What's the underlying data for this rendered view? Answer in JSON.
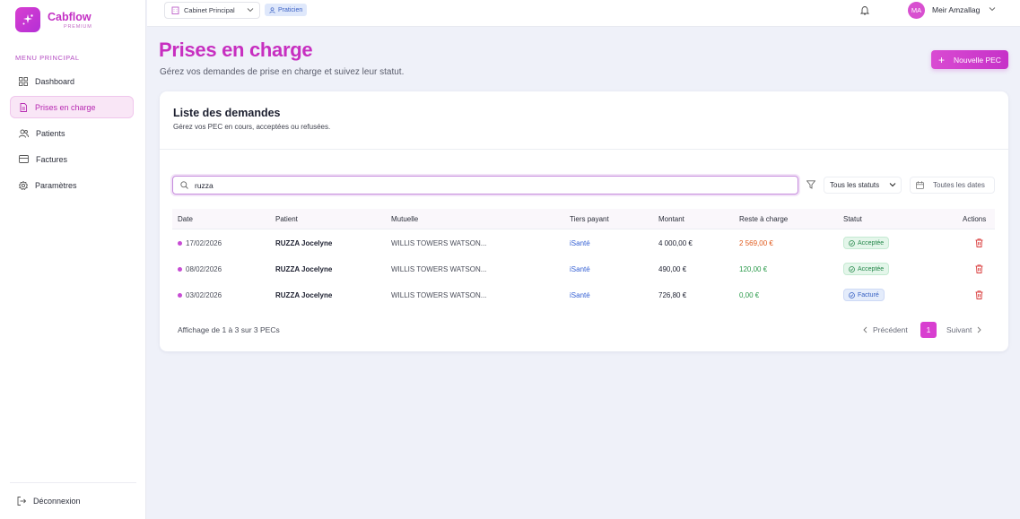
{
  "brand": {
    "name": "Cabflow",
    "tier": "PREMIUM"
  },
  "sidebar": {
    "menu_title": "MENU PRINCIPAL",
    "items": [
      {
        "label": "Dashboard",
        "icon": "dashboard-icon",
        "active": false
      },
      {
        "label": "Prises en charge",
        "icon": "document-icon",
        "active": true
      },
      {
        "label": "Patients",
        "icon": "users-icon",
        "active": false
      },
      {
        "label": "Factures",
        "icon": "credit-card-icon",
        "active": false
      },
      {
        "label": "Paramètres",
        "icon": "gear-icon",
        "active": false
      }
    ],
    "logout_label": "Déconnexion"
  },
  "topbar": {
    "cabinet": "Cabinet Principal",
    "role": "Praticien",
    "user_initials": "MA",
    "user_name": "Meir Amzallag"
  },
  "page": {
    "title": "Prises en charge",
    "subtitle": "Gérez vos demandes de prise en charge et suivez leur statut.",
    "new_button": "Nouvelle PEC"
  },
  "card": {
    "title": "Liste des demandes",
    "subtitle": "Gérez vos PEC en cours, acceptées ou refusées."
  },
  "filters": {
    "search_value": "ruzza",
    "status_value": "Tous les statuts",
    "date_value": "Toutes les dates"
  },
  "table": {
    "headers": {
      "date": "Date",
      "patient": "Patient",
      "mutuelle": "Mutuelle",
      "tiers": "Tiers payant",
      "montant": "Montant",
      "reste": "Reste à charge",
      "statut": "Statut",
      "actions": "Actions"
    },
    "rows": [
      {
        "date": "17/02/2026",
        "patient": "RUZZA Jocelyne",
        "mutuelle": "WILLIS TOWERS WATSON...",
        "tiers": "iSanté",
        "montant": "4 000,00 €",
        "reste": "2 569,00 €",
        "statut": "Acceptée"
      },
      {
        "date": "08/02/2026",
        "patient": "RUZZA Jocelyne",
        "mutuelle": "WILLIS TOWERS WATSON...",
        "tiers": "iSanté",
        "montant": "490,00 €",
        "reste": "120,00 €",
        "statut": "Acceptée"
      },
      {
        "date": "03/02/2026",
        "patient": "RUZZA Jocelyne",
        "mutuelle": "WILLIS TOWERS WATSON...",
        "tiers": "iSanté",
        "montant": "726,80 €",
        "reste": "0,00 €",
        "statut": "Facturé"
      }
    ]
  },
  "pagination": {
    "info": "Affichage de 1 à 3 sur 3 PECs",
    "prev": "Précédent",
    "current": "1",
    "next": "Suivant"
  },
  "colors": {
    "accent": "#c72fc0",
    "reste_orange": "#e05a1c",
    "reste_green": "#2a9a4a",
    "link_blue": "#3560d4"
  }
}
